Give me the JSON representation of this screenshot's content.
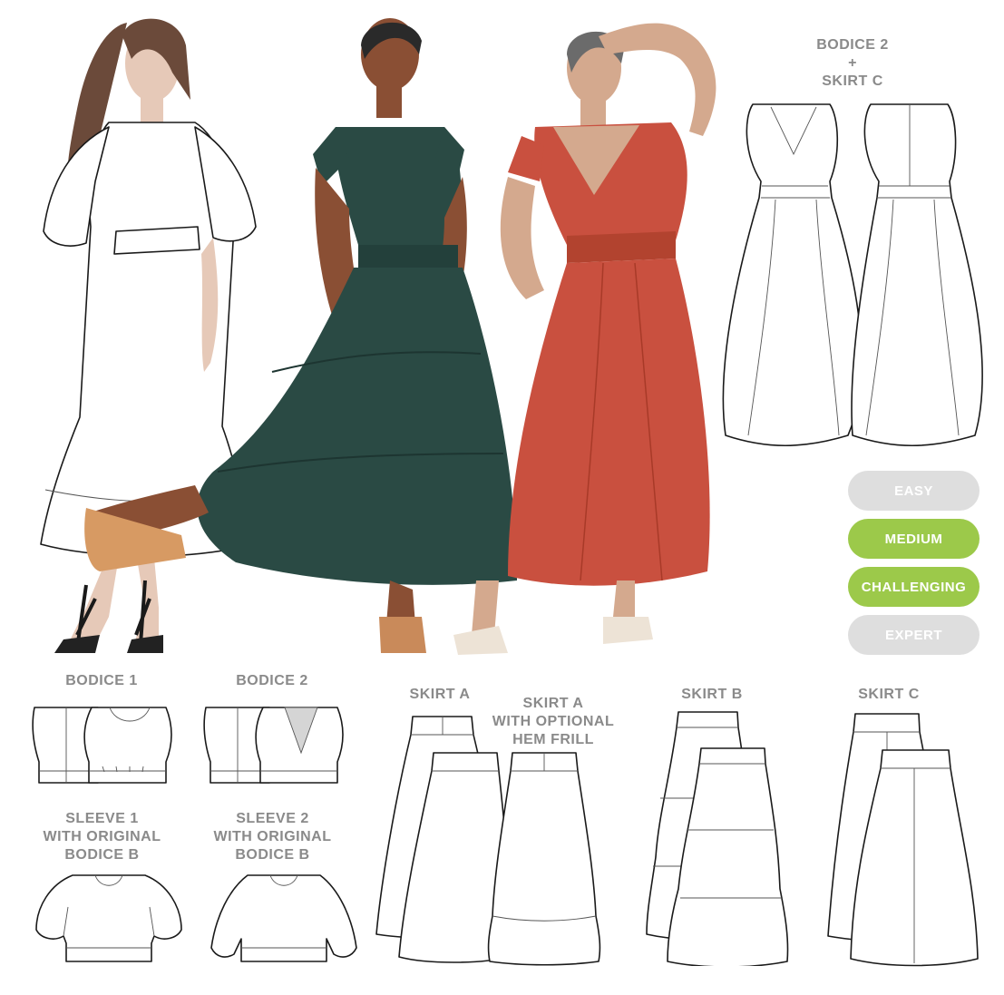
{
  "top_right_label": [
    "BODICE 2",
    "+",
    "SKIRT C"
  ],
  "difficulty": {
    "levels": [
      {
        "label": "EASY",
        "active": false
      },
      {
        "label": "MEDIUM",
        "active": true
      },
      {
        "label": "CHALLENGING",
        "active": true
      },
      {
        "label": "EXPERT",
        "active": false
      }
    ],
    "active_color": "#9cc94a",
    "inactive_color": "#dedede"
  },
  "bodice_labels": {
    "bodice1": "BODICE 1",
    "bodice2": "BODICE 2",
    "sleeve1": [
      "SLEEVE 1",
      "WITH ORIGINAL",
      "BODICE B"
    ],
    "sleeve2": [
      "SLEEVE 2",
      "WITH ORIGINAL",
      "BODICE B"
    ]
  },
  "skirt_labels": {
    "skirtA": "SKIRT A",
    "skirtA_frill": [
      "SKIRT A",
      "WITH OPTIONAL",
      "HEM FRILL"
    ],
    "skirtB": "SKIRT B",
    "skirtC": "SKIRT C"
  },
  "colors": {
    "green_dress": "#2a4a44",
    "red_dress": "#c9503f",
    "label_gray": "#8a8a8a"
  }
}
